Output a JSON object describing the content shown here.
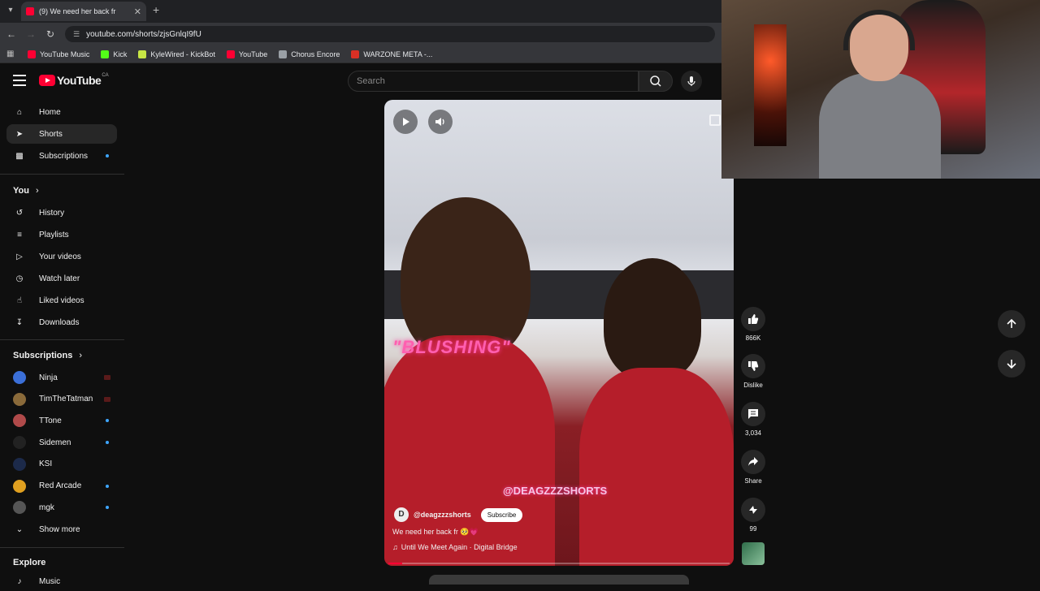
{
  "browser": {
    "tab_title": "(9) We need her back fr",
    "url": "youtube.com/shorts/zjsGnlqI9fU",
    "bookmarks": [
      {
        "label": "YouTube Music",
        "color": "#ff0033"
      },
      {
        "label": "Kick",
        "color": "#53fc18"
      },
      {
        "label": "KyleWired - KickBot",
        "color": "#c8e645"
      },
      {
        "label": "YouTube",
        "color": "#ff0033"
      },
      {
        "label": "Chorus Encore",
        "color": "#9aa0a6"
      },
      {
        "label": "WARZONE META -...",
        "color": "#d93025"
      }
    ]
  },
  "header": {
    "logo": "YouTube",
    "country": "CA",
    "search_placeholder": "Search"
  },
  "sidebar": {
    "main": [
      {
        "label": "Home",
        "icon": "home-icon"
      },
      {
        "label": "Shorts",
        "icon": "shorts-icon",
        "active": true
      },
      {
        "label": "Subscriptions",
        "icon": "subscriptions-icon",
        "dot": true
      }
    ],
    "you_heading": "You",
    "you": [
      {
        "label": "History",
        "icon": "history-icon"
      },
      {
        "label": "Playlists",
        "icon": "playlists-icon"
      },
      {
        "label": "Your videos",
        "icon": "your-videos-icon"
      },
      {
        "label": "Watch later",
        "icon": "watch-later-icon"
      },
      {
        "label": "Liked videos",
        "icon": "liked-videos-icon"
      },
      {
        "label": "Downloads",
        "icon": "downloads-icon"
      }
    ],
    "subs_heading": "Subscriptions",
    "subs": [
      {
        "label": "Ninja",
        "color": "#3b6fd8",
        "badge": "live"
      },
      {
        "label": "TimTheTatman",
        "color": "#8a6a3a",
        "badge": "live"
      },
      {
        "label": "TTone",
        "color": "#b04a4a",
        "badge": "dot"
      },
      {
        "label": "Sidemen",
        "color": "#222222",
        "badge": "dot"
      },
      {
        "label": "KSI",
        "color": "#1c2a4a",
        "badge": "none"
      },
      {
        "label": "Red Arcade",
        "color": "#e0a020",
        "badge": "dot"
      },
      {
        "label": "mgk",
        "color": "#555555",
        "badge": "dot"
      }
    ],
    "show_more": "Show more",
    "explore_heading": "Explore",
    "explore": [
      {
        "label": "Music"
      }
    ]
  },
  "short": {
    "overlay_text": "\"BLUSHING\"",
    "watermark": "@DEAGZZZSHORTS",
    "channel_initial": "D",
    "channel": "@deagzzzshorts",
    "subscribe": "Subscribe",
    "caption": "We need her back fr 🥺💗",
    "music": "Until We Meet Again · Digital Bridge",
    "progress": 0.04
  },
  "actions": {
    "likes": "866K",
    "dislike": "Dislike",
    "comments": "3,034",
    "share": "Share",
    "remix": "99"
  }
}
